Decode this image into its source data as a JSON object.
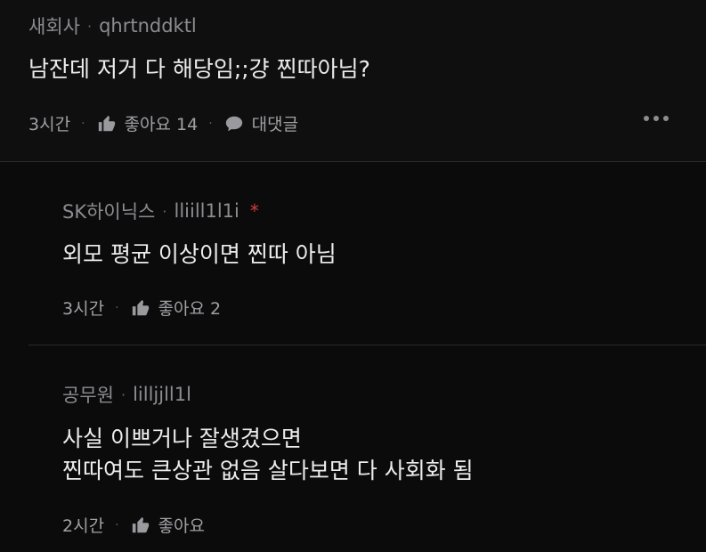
{
  "comment": {
    "author": "새회사",
    "username": "qhrtnddktl",
    "text": "남잔데 저거 다 해당임;;걍 찐따아님?",
    "time": "3시간",
    "like_label": "좋아요 14",
    "reply_label": "대댓글"
  },
  "replies": [
    {
      "author": "SK하이닉스",
      "username": "lliill1l1i",
      "star": "*",
      "text_lines": [
        "외모 평균 이상이면 찐따 아님"
      ],
      "time": "3시간",
      "like_label": "좋아요 2"
    },
    {
      "author": "공무원",
      "username": "lilljjll1l",
      "text_lines": [
        "사실 이쁘거나 잘생겼으면",
        "찐따여도 큰상관 없음 살다보면 다 사회화 됨"
      ],
      "time": "2시간",
      "like_label": "좋아요"
    }
  ],
  "separator": "·",
  "icons": {
    "like": "thumbs-up-icon",
    "reply": "speech-bubble-icon",
    "more": "more-dots-icon"
  }
}
